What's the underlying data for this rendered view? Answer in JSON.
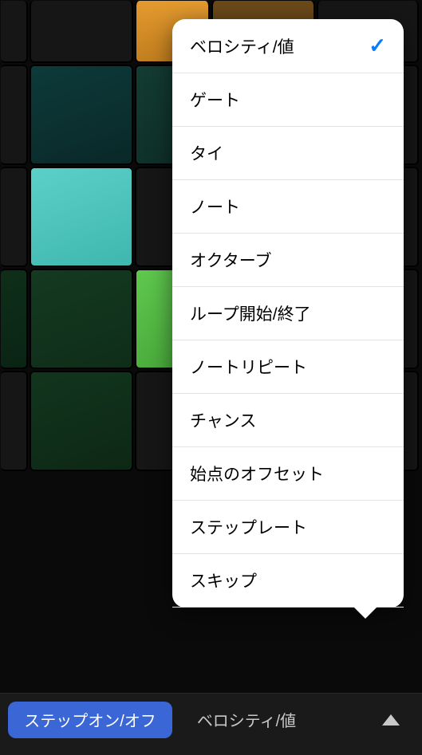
{
  "popup": {
    "items": [
      {
        "label": "ベロシティ/値",
        "selected": true
      },
      {
        "label": "ゲート",
        "selected": false
      },
      {
        "label": "タイ",
        "selected": false
      },
      {
        "label": "ノート",
        "selected": false
      },
      {
        "label": "オクターブ",
        "selected": false
      },
      {
        "label": "ループ開始/終了",
        "selected": false
      },
      {
        "label": "ノートリピート",
        "selected": false
      },
      {
        "label": "チャンス",
        "selected": false
      },
      {
        "label": "始点のオフセット",
        "selected": false
      },
      {
        "label": "ステップレート",
        "selected": false
      },
      {
        "label": "スキップ",
        "selected": false
      }
    ]
  },
  "toolbar": {
    "step_toggle_label": "ステップオン/オフ",
    "mode_label": "ベロシティ/値"
  },
  "grid": {
    "rows": 5,
    "cols": 5,
    "colors": {
      "orange_bright": "#e49a2f",
      "orange_dim": "#6d4a1a",
      "teal_dark": "#0d3a3a",
      "teal_bright": "#5bd0c8",
      "green_bright": "#5fc84e",
      "green_dim": "#12351d",
      "inactive": "#161616"
    }
  }
}
